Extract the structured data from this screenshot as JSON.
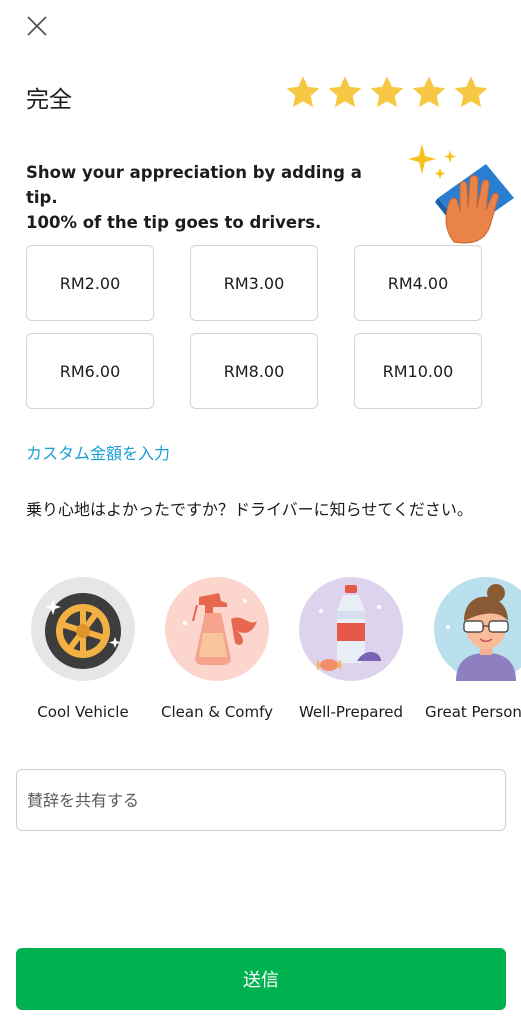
{
  "header": {
    "close_icon": "close-icon"
  },
  "rating": {
    "title": "完全",
    "value": 5,
    "max": 5,
    "star_color": "#f7c844"
  },
  "tip": {
    "message_line1": "Show your appreciation by adding a tip.",
    "message_line2": "100% of the tip goes to drivers.",
    "amounts": [
      "RM2.00",
      "RM3.00",
      "RM4.00",
      "RM6.00",
      "RM8.00",
      "RM10.00"
    ],
    "custom_link": "カスタム金額を入力"
  },
  "feedback": {
    "question": "乗り心地はよかったですか？ドライバーに知らせてください。",
    "compliments": [
      "Cool Vehicle",
      "Clean & Comfy",
      "Well-Prepared",
      "Great Persona"
    ]
  },
  "comment": {
    "placeholder": "賛辞を共有する"
  },
  "submit": {
    "label": "送信"
  },
  "colors": {
    "accent_green": "#00b14f",
    "link_blue": "#1a9fd6"
  }
}
